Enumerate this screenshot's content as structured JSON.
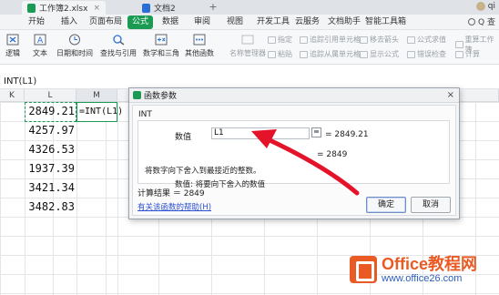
{
  "titlebar": {
    "tabs": [
      {
        "label": "工作簿2.xlsx",
        "icon": "spreadsheet-icon",
        "color": "#1a9a52",
        "active": true
      },
      {
        "label": "文档2",
        "icon": "document-icon",
        "color": "#2a6fd6",
        "active": false
      }
    ],
    "close_glyph": "×",
    "add_glyph": "+",
    "user": "qi"
  },
  "menu": {
    "items": [
      "开始",
      "插入",
      "页面布局",
      "公式",
      "数据",
      "审阅",
      "视图",
      "开发工具",
      "云服务",
      "文档助手",
      "智能工具箱"
    ],
    "active": "公式",
    "search_label": "Q 查"
  },
  "ribbon": {
    "buttons": [
      "逻辑",
      "文本",
      "日期和时间",
      "查找与引用",
      "数学和三角",
      "其他函数"
    ],
    "disabled": [
      "名称管理器",
      "指定",
      "粘贴",
      "追踪引用单元格",
      "追踪从属单元格",
      "移去箭头",
      "显示公式",
      "公式求值",
      "错误检查",
      "重算工作簿",
      "计算"
    ]
  },
  "formula_bar": {
    "text": "INT(L1)"
  },
  "columns": [
    "K",
    "L",
    "M"
  ],
  "cells": {
    "values": [
      "2849.21",
      "4257.97",
      "4326.53",
      "1937.39",
      "3421.34",
      "3482.83"
    ],
    "formula": "=INT(L1)"
  },
  "dialog": {
    "title": "函数参数",
    "close_glyph": "×",
    "function_name": "INT",
    "param_label": "数值",
    "param_value": "L1",
    "param_result": "= 2849.21",
    "result_inline": "= 2849",
    "description": "将数字向下舍入到最接近的整数。",
    "param_desc": "数值:  将要向下舍入的数值",
    "calc_result": "计算结果 ＝ 2849",
    "help_link": "有关该函数的帮助(H)",
    "ok_label": "确定",
    "cancel_label": "取消"
  },
  "watermark": {
    "title": "Office教程网",
    "url": "www.office26.com"
  },
  "colors": {
    "accent": "#1a9a52",
    "arrow": "#e5132a",
    "brand": "#ea5a24"
  }
}
